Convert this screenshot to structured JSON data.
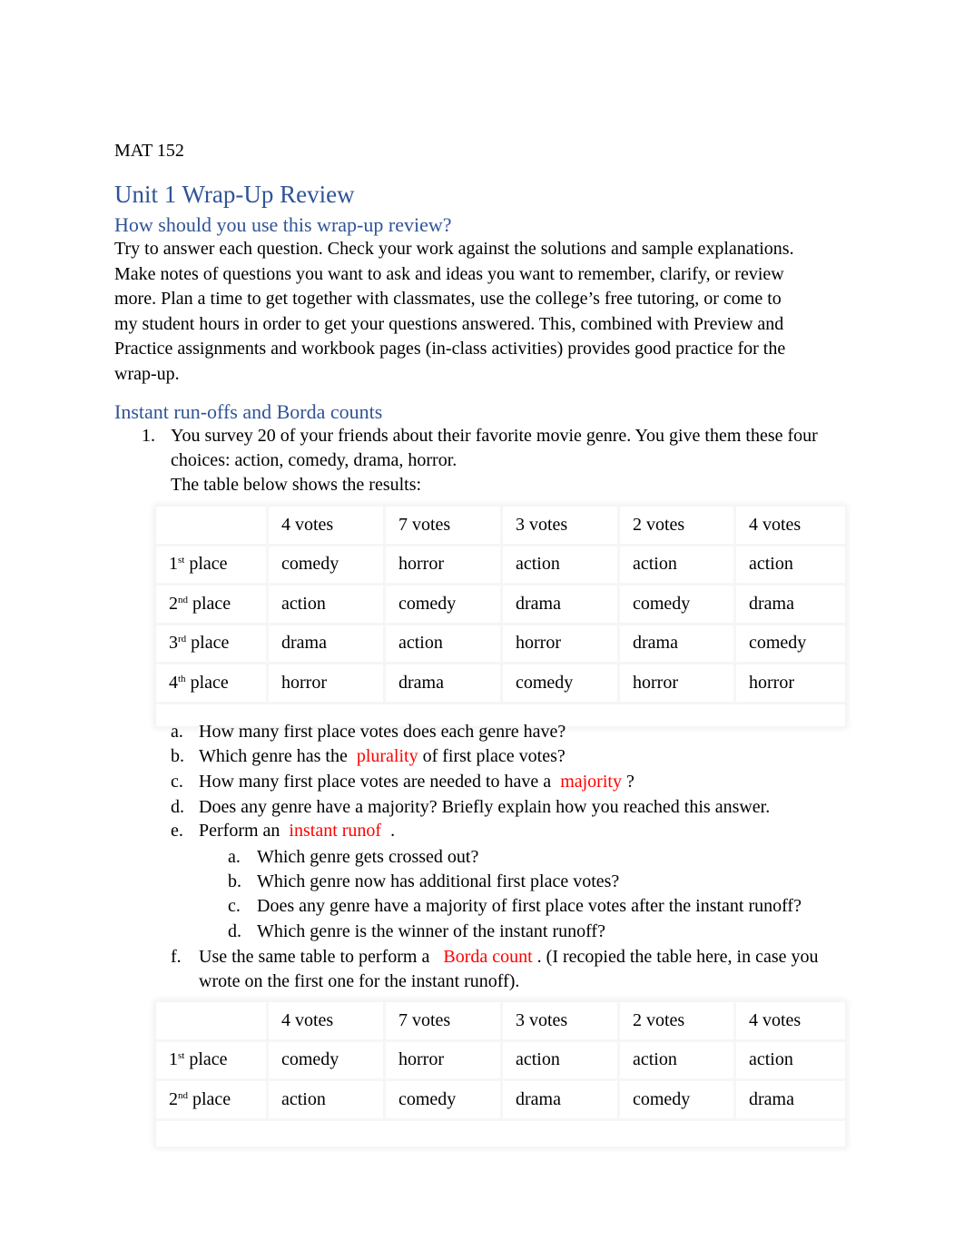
{
  "course": "MAT 152",
  "title": "Unit 1 Wrap-Up Review",
  "section1": {
    "heading": "How should you use this wrap-up review?",
    "lines": [
      "Try to answer each question. Check your work against the solutions and sample explanations.",
      "Make notes of questions you want to ask and ideas you want to remember, clarify, or review",
      "more. Plan a time to get together with classmates, use the college’s free tutoring, or come to",
      "my student hours in order to get your questions answered. This, combined with Preview and",
      "Practice assignments and workbook pages (in-class activities) provides good practice for the",
      "wrap-up."
    ]
  },
  "section2": {
    "heading": "Instant run-offs and Borda counts",
    "q1": {
      "number": "1.",
      "lines": [
        "You survey 20 of your friends about their favorite movie genre. You give them these four",
        "choices: action, comedy, drama, horror.",
        "The table below shows the results:"
      ],
      "table": {
        "headers": [
          "",
          "4 votes",
          "7 votes",
          "3 votes",
          "2 votes",
          "4 votes"
        ],
        "rows": [
          {
            "num": "1",
            "sup": "st",
            "label": " place",
            "cells": [
              "comedy",
              "horror",
              "action",
              "action",
              "action"
            ]
          },
          {
            "num": "2",
            "sup": "nd",
            "label": " place",
            "cells": [
              "action",
              "comedy",
              "drama",
              "comedy",
              "drama"
            ]
          },
          {
            "num": "3",
            "sup": "rd",
            "label": " place",
            "cells": [
              "drama",
              "action",
              "horror",
              "drama",
              "comedy"
            ]
          },
          {
            "num": "4",
            "sup": "th",
            "label": " place",
            "cells": [
              "horror",
              "drama",
              "comedy",
              "horror",
              "horror"
            ]
          }
        ]
      },
      "subquestions": [
        {
          "marker": "a.",
          "text": "How many first place votes does each genre have?"
        },
        {
          "marker": "b.",
          "pre": "Which genre has the ",
          "term": "plurality",
          "post": " of first place votes?"
        },
        {
          "marker": "c.",
          "pre": "How many first place votes are needed to have a ",
          "term": "majority",
          "post": " ?"
        },
        {
          "marker": "d.",
          "text": "Does any genre have a majority? Briefly explain how you reached this answer."
        },
        {
          "marker": "e.",
          "pre": "Perform an ",
          "term": "instant runof",
          "post": "  ."
        }
      ],
      "e_sub": [
        {
          "marker": "a.",
          "text": "Which genre gets crossed out?"
        },
        {
          "marker": "b.",
          "text": "Which genre now has additional first place votes?"
        },
        {
          "marker": "c.",
          "text": "Does any genre have a majority of first place votes after the instant runoff?"
        },
        {
          "marker": "d.",
          "text": "Which genre is the winner of the instant runoff?"
        }
      ],
      "f": {
        "marker": "f.",
        "pre": "Use the same table to perform a ",
        "term": "Borda count",
        "post": " . (I recopied the table here, in case you",
        "line2": "wrote on the first one for the instant runoff)."
      },
      "table2": {
        "headers": [
          "",
          "4 votes",
          "7 votes",
          "3 votes",
          "2 votes",
          "4 votes"
        ],
        "rows": [
          {
            "num": "1",
            "sup": "st",
            "label": " place",
            "cells": [
              "comedy",
              "horror",
              "action",
              "action",
              "action"
            ]
          },
          {
            "num": "2",
            "sup": "nd",
            "label": " place",
            "cells": [
              "action",
              "comedy",
              "drama",
              "comedy",
              "drama"
            ]
          }
        ]
      }
    }
  },
  "colors": {
    "heading": "#2f5496",
    "term": "#ff0000"
  }
}
